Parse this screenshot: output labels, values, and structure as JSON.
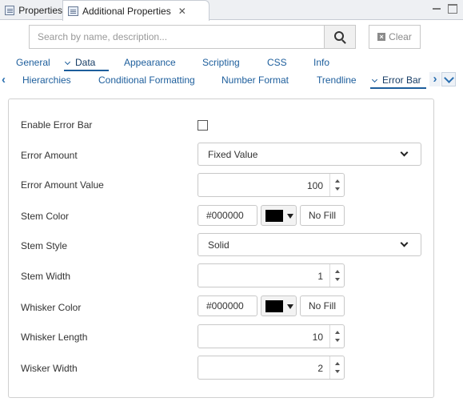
{
  "view_tabs": [
    {
      "label": "Properties"
    },
    {
      "label": "Additional Properties",
      "close": "✕"
    }
  ],
  "search": {
    "placeholder": "Search by name, description...",
    "clear_label": "Clear"
  },
  "tabs_row1": [
    "General",
    "Data",
    "Appearance",
    "Scripting",
    "CSS",
    "Info"
  ],
  "tabs_row2": [
    "Hierarchies",
    "Conditional Formatting",
    "Number Format",
    "Trendline",
    "Error Bar"
  ],
  "nav": {
    "left": "‹",
    "right": "›"
  },
  "form": {
    "enable_error_bar": {
      "label": "Enable Error Bar",
      "checked": false
    },
    "error_amount": {
      "label": "Error Amount",
      "value": "Fixed Value"
    },
    "error_amount_value": {
      "label": "Error Amount Value",
      "value": "100"
    },
    "stem_color": {
      "label": "Stem Color",
      "hex": "#000000",
      "no_fill": "No Fill"
    },
    "stem_style": {
      "label": "Stem Style",
      "value": "Solid"
    },
    "stem_width": {
      "label": "Stem Width",
      "value": "1"
    },
    "whisker_color": {
      "label": "Whisker Color",
      "hex": "#000000",
      "no_fill": "No Fill"
    },
    "whisker_length": {
      "label": "Whisker Length",
      "value": "10"
    },
    "wisker_width": {
      "label": "Wisker Width",
      "value": "2"
    }
  },
  "colors": {
    "link": "#1d5e9c",
    "swatch": "#000000"
  }
}
